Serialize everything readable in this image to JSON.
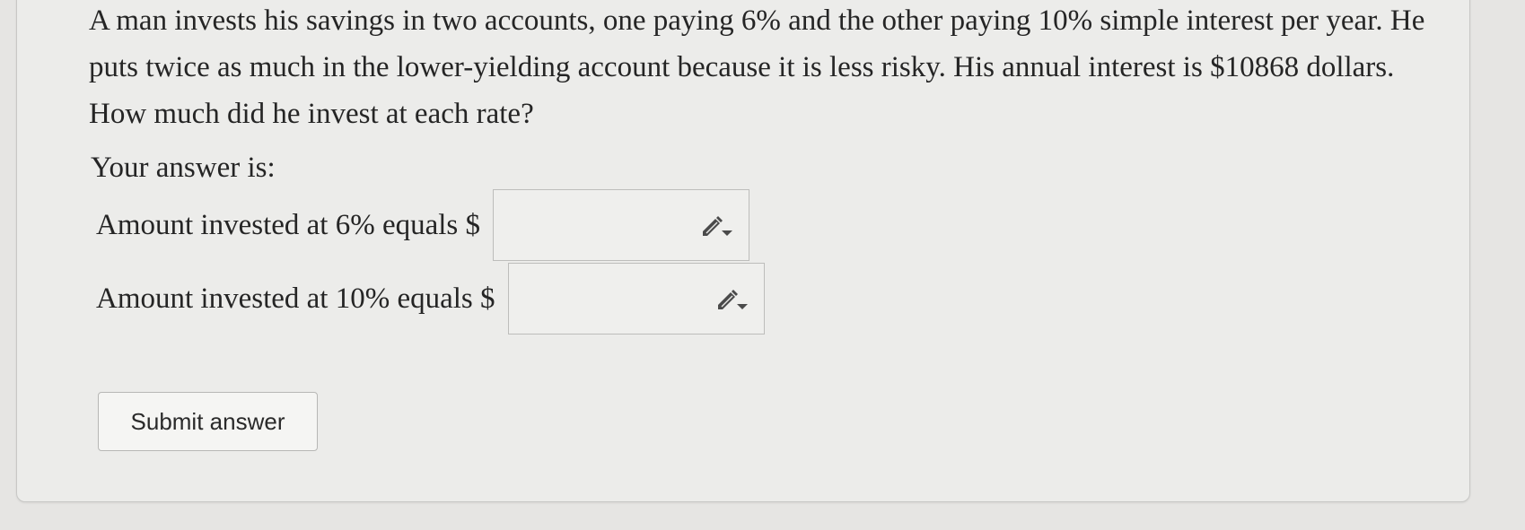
{
  "question": {
    "text": "A man invests his savings in two accounts, one paying 6% and the other paying 10% simple interest per year. He puts twice as much in the lower-yielding account because it is less risky. His annual interest is $10868 dollars. How much did he invest at each rate?"
  },
  "answer_intro": "Your answer is:",
  "answers": [
    {
      "label": "Amount invested at 6% equals $",
      "value": "",
      "icon": "edit-pencil-dropdown-icon"
    },
    {
      "label": "Amount invested at 10% equals $",
      "value": "",
      "icon": "edit-pencil-dropdown-icon"
    }
  ],
  "submit": {
    "label": "Submit answer"
  },
  "colors": {
    "background": "#e6e5e3",
    "panel": "#ececea",
    "text": "#252525",
    "border": "#bdbdbb",
    "icon": "#4a4a4a"
  }
}
